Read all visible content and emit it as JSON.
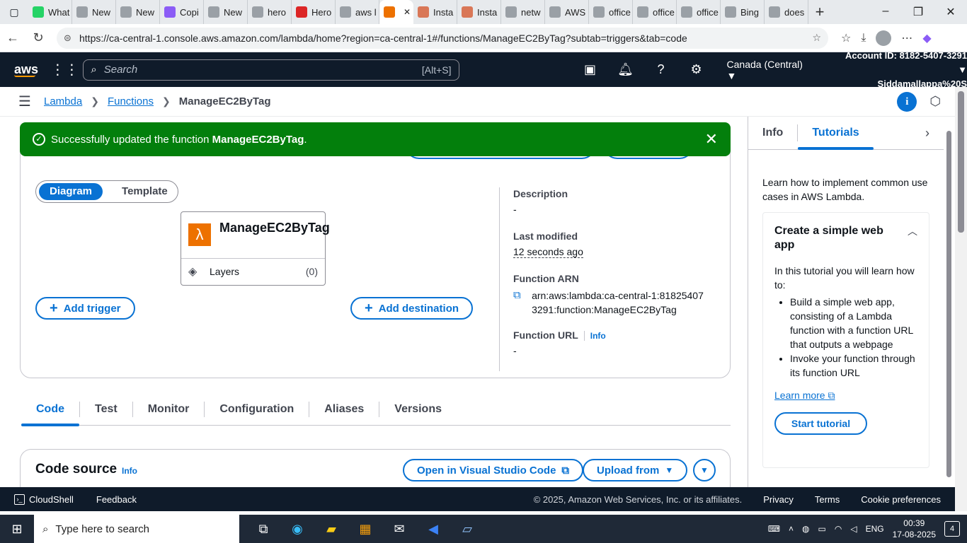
{
  "browser": {
    "tabs": [
      {
        "label": "What",
        "color": "#25d366"
      },
      {
        "label": "New",
        "color": "#9aa0a6"
      },
      {
        "label": "New",
        "color": "#9aa0a6"
      },
      {
        "label": "Copi",
        "color": "#8b5cf6"
      },
      {
        "label": "New",
        "color": "#9aa0a6"
      },
      {
        "label": "hero",
        "color": "#9aa0a6"
      },
      {
        "label": "Hero",
        "color": "#dc2626"
      },
      {
        "label": "aws l",
        "color": "#9aa0a6"
      },
      {
        "label": "",
        "color": "#ed7100",
        "active": true
      },
      {
        "label": "Insta",
        "color": "#d97757"
      },
      {
        "label": "Insta",
        "color": "#d97757"
      },
      {
        "label": "netw",
        "color": "#9aa0a6"
      },
      {
        "label": "AWS",
        "color": "#9aa0a6"
      },
      {
        "label": "office",
        "color": "#9aa0a6"
      },
      {
        "label": "office",
        "color": "#9aa0a6"
      },
      {
        "label": "office",
        "color": "#9aa0a6"
      },
      {
        "label": "Bing",
        "color": "#9aa0a6"
      },
      {
        "label": "does",
        "color": "#9aa0a6"
      }
    ],
    "url": "https://ca-central-1.console.aws.amazon.com/lambda/home?region=ca-central-1#/functions/ManageEC2ByTag?subtab=triggers&tab=code"
  },
  "aws_header": {
    "logo": "aws",
    "search_placeholder": "Search",
    "search_hint": "[Alt+S]",
    "region": "Canada (Central) ▼",
    "account_id": "Account ID: 8182-5407-3291 ▼",
    "user": "Siddamallappa%20S"
  },
  "breadcrumb": {
    "items": [
      "Lambda",
      "Functions"
    ],
    "current": "ManageEC2ByTag"
  },
  "flash": {
    "prefix": "Successfully updated the function ",
    "function_name": "ManageEC2ByTag",
    "suffix": "."
  },
  "overview": {
    "segment": {
      "diagram": "Diagram",
      "template": "Template"
    },
    "function_name": "ManageEC2ByTag",
    "layers_label": "Layers",
    "layers_count": "(0)",
    "add_trigger": "Add trigger",
    "add_destination": "Add destination",
    "description_label": "Description",
    "description_value": "-",
    "last_modified_label": "Last modified",
    "last_modified_value": "12 seconds ago",
    "arn_label": "Function ARN",
    "arn_value": "arn:aws:lambda:ca-central-1:818254073291:function:ManageEC2ByTag",
    "url_label": "Function URL",
    "url_info": "Info",
    "url_value": "-"
  },
  "main_tabs": [
    "Code",
    "Test",
    "Monitor",
    "Configuration",
    "Aliases",
    "Versions"
  ],
  "code_source": {
    "title": "Code source",
    "info": "Info",
    "open_vscode": "Open in Visual Studio Code",
    "upload_from": "Upload from"
  },
  "help_panel": {
    "tab_info": "Info",
    "tab_tutorials": "Tutorials",
    "intro": "Learn how to implement common use cases in AWS Lambda.",
    "card_title": "Create a simple web app",
    "card_intro": "In this tutorial you will learn how to:",
    "bullets": [
      "Build a simple web app, consisting of a Lambda function with a function URL that outputs a webpage",
      "Invoke your function through its function URL"
    ],
    "learn_more": "Learn more",
    "start_tutorial": "Start tutorial"
  },
  "footer": {
    "cloudshell": "CloudShell",
    "feedback": "Feedback",
    "copyright": "© 2025, Amazon Web Services, Inc. or its affiliates.",
    "privacy": "Privacy",
    "terms": "Terms",
    "cookies": "Cookie preferences"
  },
  "taskbar": {
    "search_placeholder": "Type here to search",
    "lang": "ENG",
    "time": "00:39",
    "date": "17-08-2025",
    "notifications": "4"
  },
  "colors": {
    "aws_nav": "#0f1b2a",
    "link_blue": "#0972d3",
    "success_green": "#037f0c",
    "lambda_orange": "#ed7100"
  }
}
